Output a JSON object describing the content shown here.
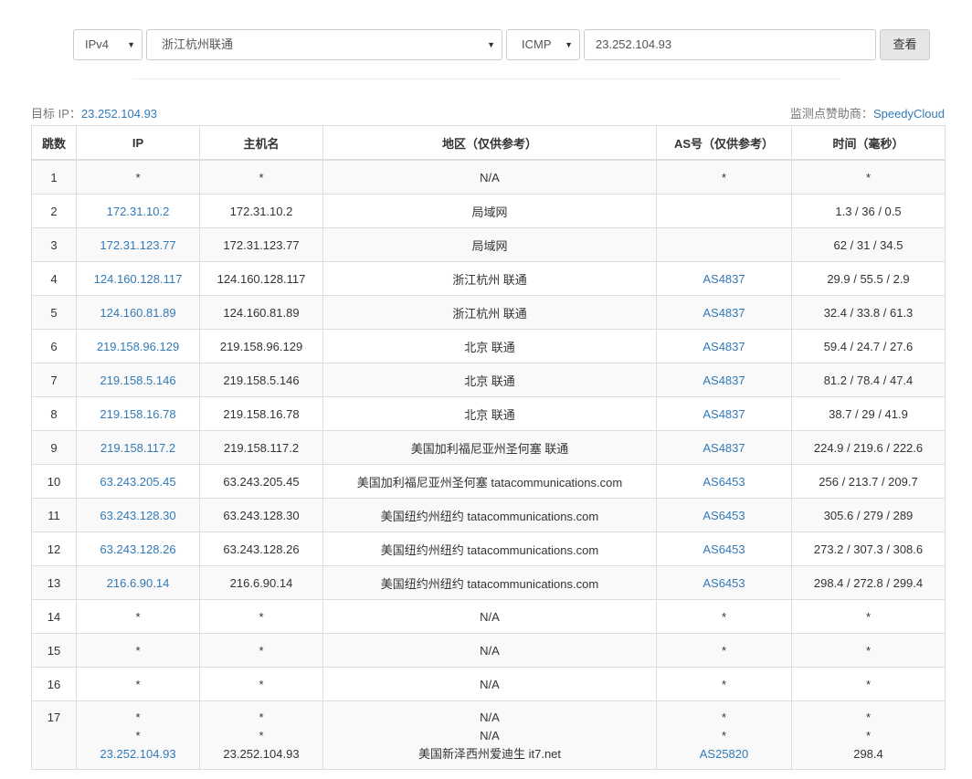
{
  "toolbar": {
    "ip_version": "IPv4",
    "node": "浙江杭州联通",
    "protocol": "ICMP",
    "target_input_value": "23.252.104.93",
    "query_label": "查看",
    "caret": "▼"
  },
  "meta": {
    "target_prefix": "目标 IP：",
    "target_ip": "23.252.104.93",
    "sponsor_prefix": "监测点赞助商：",
    "sponsor_name": "SpeedyCloud"
  },
  "table": {
    "headers": [
      "跳数",
      "IP",
      "主机名",
      "地区（仅供参考）",
      "AS号（仅供参考）",
      "时间（毫秒）"
    ],
    "rows": [
      {
        "hop": "1",
        "ip": "*",
        "host": "*",
        "region": "N/A",
        "as": "*",
        "time": "*"
      },
      {
        "hop": "2",
        "ip": "172.31.10.2",
        "host": "172.31.10.2",
        "region": "局域网",
        "as": "",
        "time": "1.3 / 36 / 0.5"
      },
      {
        "hop": "3",
        "ip": "172.31.123.77",
        "host": "172.31.123.77",
        "region": "局域网",
        "as": "",
        "time": "62 / 31 / 34.5"
      },
      {
        "hop": "4",
        "ip": "124.160.128.117",
        "host": "124.160.128.117",
        "region": "浙江杭州 联通",
        "as": "AS4837",
        "time": "29.9 / 55.5 / 2.9"
      },
      {
        "hop": "5",
        "ip": "124.160.81.89",
        "host": "124.160.81.89",
        "region": "浙江杭州 联通",
        "as": "AS4837",
        "time": "32.4 / 33.8 / 61.3"
      },
      {
        "hop": "6",
        "ip": "219.158.96.129",
        "host": "219.158.96.129",
        "region": "北京 联通",
        "as": "AS4837",
        "time": "59.4 / 24.7 / 27.6"
      },
      {
        "hop": "7",
        "ip": "219.158.5.146",
        "host": "219.158.5.146",
        "region": "北京 联通",
        "as": "AS4837",
        "time": "81.2 / 78.4 / 47.4"
      },
      {
        "hop": "8",
        "ip": "219.158.16.78",
        "host": "219.158.16.78",
        "region": "北京 联通",
        "as": "AS4837",
        "time": "38.7 / 29 / 41.9"
      },
      {
        "hop": "9",
        "ip": "219.158.117.2",
        "host": "219.158.117.2",
        "region": "美国加利福尼亚州圣何塞 联通",
        "as": "AS4837",
        "time": "224.9 / 219.6 / 222.6"
      },
      {
        "hop": "10",
        "ip": "63.243.205.45",
        "host": "63.243.205.45",
        "region": "美国加利福尼亚州圣何塞 tatacommunications.com",
        "as": "AS6453",
        "time": "256 / 213.7 / 209.7"
      },
      {
        "hop": "11",
        "ip": "63.243.128.30",
        "host": "63.243.128.30",
        "region": "美国纽约州纽约 tatacommunications.com",
        "as": "AS6453",
        "time": "305.6 / 279 / 289"
      },
      {
        "hop": "12",
        "ip": "63.243.128.26",
        "host": "63.243.128.26",
        "region": "美国纽约州纽约 tatacommunications.com",
        "as": "AS6453",
        "time": "273.2 / 307.3 / 308.6"
      },
      {
        "hop": "13",
        "ip": "216.6.90.14",
        "host": "216.6.90.14",
        "region": "美国纽约州纽约 tatacommunications.com",
        "as": "AS6453",
        "time": "298.4 / 272.8 / 299.4"
      },
      {
        "hop": "14",
        "ip": "*",
        "host": "*",
        "region": "N/A",
        "as": "*",
        "time": "*"
      },
      {
        "hop": "15",
        "ip": "*",
        "host": "*",
        "region": "N/A",
        "as": "*",
        "time": "*"
      },
      {
        "hop": "16",
        "ip": "*",
        "host": "*",
        "region": "N/A",
        "as": "*",
        "time": "*"
      }
    ],
    "last_row": {
      "hop": "17",
      "ip": [
        "*",
        "*",
        "23.252.104.93"
      ],
      "host": [
        "*",
        "*",
        "23.252.104.93"
      ],
      "region": [
        "N/A",
        "N/A",
        "美国新泽西州爱迪生 it7.net"
      ],
      "as": [
        "*",
        "*",
        "AS25820"
      ],
      "time": [
        "*",
        "*",
        "298.4"
      ]
    }
  },
  "colors": {
    "link": "#337ab7",
    "border": "#dddddd",
    "stripe": "#f9f9f9",
    "button_bg": "#e6e6e6"
  }
}
